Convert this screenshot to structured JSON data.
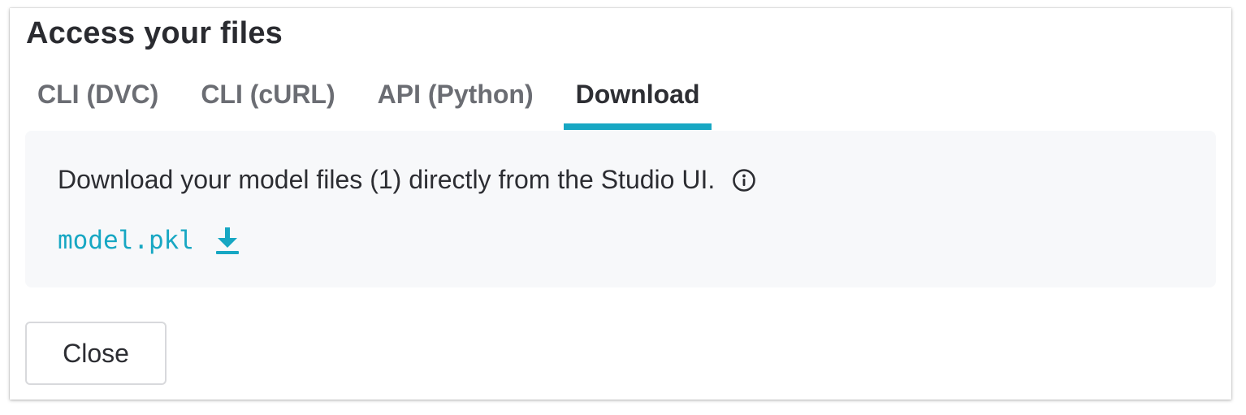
{
  "dialog": {
    "title": "Access your files",
    "tabs": [
      {
        "label": "CLI (DVC)",
        "active": false
      },
      {
        "label": "CLI (cURL)",
        "active": false
      },
      {
        "label": "API (Python)",
        "active": false
      },
      {
        "label": "Download",
        "active": true
      }
    ],
    "panel": {
      "description": "Download your model files (1) directly from the Studio UI.",
      "info_icon": "info-icon",
      "files": [
        {
          "name": "model.pkl",
          "icon": "download-icon"
        }
      ]
    },
    "close_label": "Close"
  },
  "colors": {
    "accent": "#17a7c3",
    "panel_bg": "#f7f8fa",
    "inactive_tab": "#6b6d73",
    "text": "#2c2d32"
  }
}
